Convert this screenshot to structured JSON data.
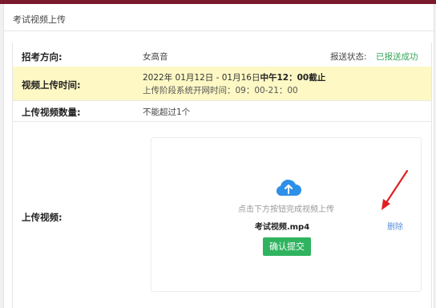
{
  "header": {
    "title": "考试视频上传"
  },
  "rows": {
    "direction": {
      "label": "招考方向:",
      "value": "女高音",
      "status_label": "报送状态:",
      "status_value": "已报送成功"
    },
    "upload_time": {
      "label": "视频上传时间:",
      "line1_prefix": "2022年 01月12日 - 01月16日",
      "line1_bold": "中午12：00截止",
      "line2": "上传阶段系统开网时间：09：00-21：00"
    },
    "count": {
      "label": "上传视频数量:",
      "value": "不能超过1个"
    },
    "upload": {
      "label": "上传视频:",
      "hint": "点击下方按钮完成视频上传",
      "file_name": "考试视频.mp4",
      "delete_label": "删除",
      "submit_label": "确认提交"
    }
  },
  "colors": {
    "brand": "#7b1a2c",
    "highlight_row": "#fdf8c4",
    "success": "#36a65a",
    "button": "#2fb35f",
    "link": "#5a8fd8",
    "annotation_arrow": "#e02020"
  },
  "icons": {
    "upload": "cloud-upload-icon",
    "annotation": "red-arrow-annotation"
  }
}
